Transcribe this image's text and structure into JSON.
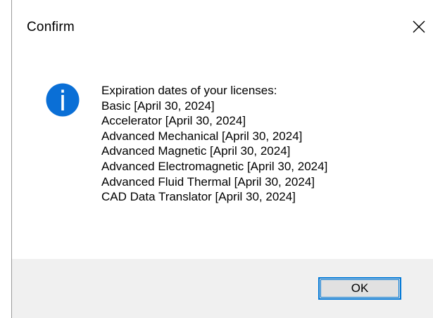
{
  "window": {
    "title": "Confirm",
    "close_icon": "close-icon"
  },
  "message": {
    "icon": "info-icon",
    "lines": [
      "Expiration dates of your licenses:",
      "Basic [April 30, 2024]",
      "Accelerator [April 30, 2024]",
      "Advanced Mechanical [April 30, 2024]",
      "Advanced Magnetic [April 30, 2024]",
      "Advanced Electromagnetic [April 30, 2024]",
      "Advanced Fluid Thermal [April 30, 2024]",
      "CAD Data Translator [April 30, 2024]"
    ]
  },
  "buttons": {
    "ok_label": "OK"
  },
  "colors": {
    "info_icon": "#0a6fd6",
    "button_border": "#0078d7",
    "footer_bg": "#f0f0f0"
  }
}
